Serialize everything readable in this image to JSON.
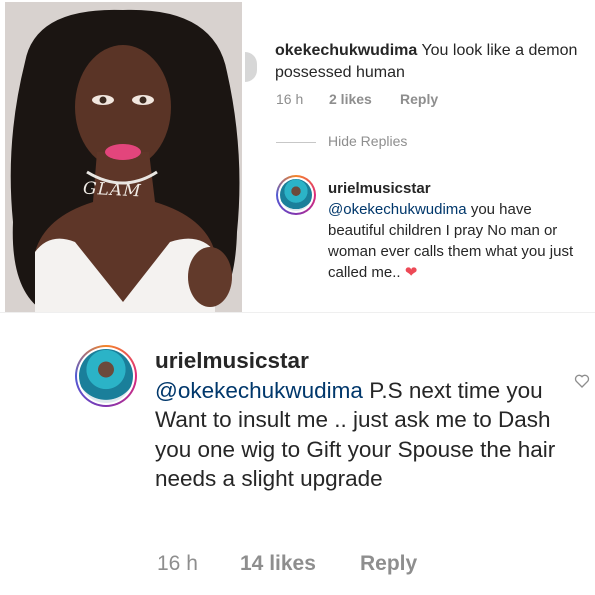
{
  "thread": {
    "comment": {
      "username": "okekechukwudima",
      "text": "You look like a demon possessed human",
      "time": "16 h",
      "likes": "2 likes",
      "reply_label": "Reply"
    },
    "hide_replies_label": "Hide Replies",
    "reply": {
      "username": "urielmusicstar",
      "mention": "@okekechukwudima",
      "text": "you have beautiful children I pray No man or woman ever calls them what you just called me..",
      "emoji": "❤"
    }
  },
  "photo": {
    "necklace_text": "GLAM"
  },
  "big_reply": {
    "username": "urielmusicstar",
    "mention": "@okekechukwudima",
    "text": "P.S next time you Want to insult me .. just ask me to Dash you one wig to Gift your Spouse  the hair needs a slight upgrade",
    "time": "16 h",
    "likes": "14 likes",
    "reply_label": "Reply"
  },
  "colors": {
    "text": "#262626",
    "meta": "#8e8e8e",
    "mention": "#00376b",
    "heart": "#ed4956"
  },
  "icons": {
    "like": "heart-outline-icon",
    "emoji": "red-heart-emoji"
  }
}
